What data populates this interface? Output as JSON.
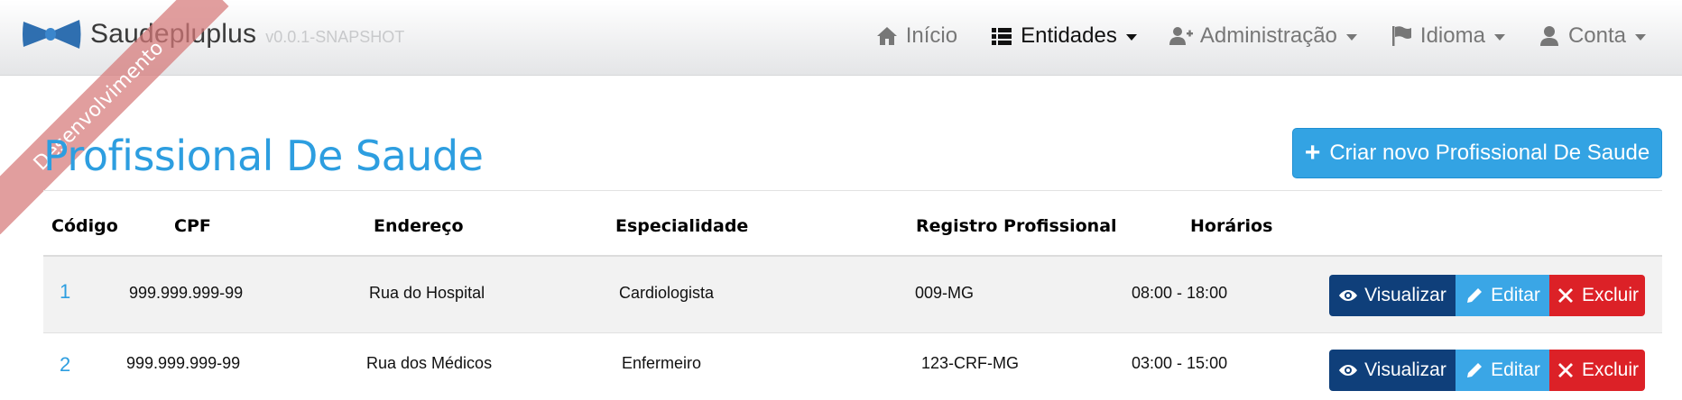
{
  "navbar": {
    "brand_name": "Saudepluplus",
    "brand_version": "v0.0.1-SNAPSHOT",
    "items": [
      {
        "label": "Início",
        "icon": "home-icon",
        "dropdown": false,
        "active": false
      },
      {
        "label": "Entidades",
        "icon": "list-icon",
        "dropdown": true,
        "active": true
      },
      {
        "label": "Administração",
        "icon": "user-plus-icon",
        "dropdown": true,
        "active": false
      },
      {
        "label": "Idioma",
        "icon": "flag-icon",
        "dropdown": true,
        "active": false
      },
      {
        "label": "Conta",
        "icon": "user-icon",
        "dropdown": true,
        "active": false
      }
    ]
  },
  "ribbon": {
    "label": "Desenvolvimento"
  },
  "page": {
    "title": "Profissional De Saude",
    "create_button": "Criar novo Profissional De Saude"
  },
  "table": {
    "headers": [
      "Código",
      "CPF",
      "Endereço",
      "Especialidade",
      "Registro Profissional",
      "Horários"
    ],
    "rows": [
      {
        "codigo": "1",
        "cpf": "999.999.999-99",
        "endereco": "Rua do Hospital",
        "especialidade": "Cardiologista",
        "registro": "009-MG",
        "horarios": "08:00 - 18:00"
      },
      {
        "codigo": "2",
        "cpf": "999.999.999-99",
        "endereco": "Rua dos Médicos",
        "especialidade": "Enfermeiro",
        "registro": "123-CRF-MG",
        "horarios": "03:00 - 15:00"
      }
    ],
    "actions": {
      "view": "Visualizar",
      "edit": "Editar",
      "delete": "Excluir"
    }
  },
  "colors": {
    "accent": "#2d9ee0",
    "view_button": "#0f3f7a",
    "edit_button": "#3aa6e6",
    "delete_button": "#dc2127",
    "ribbon": "#d67878"
  }
}
